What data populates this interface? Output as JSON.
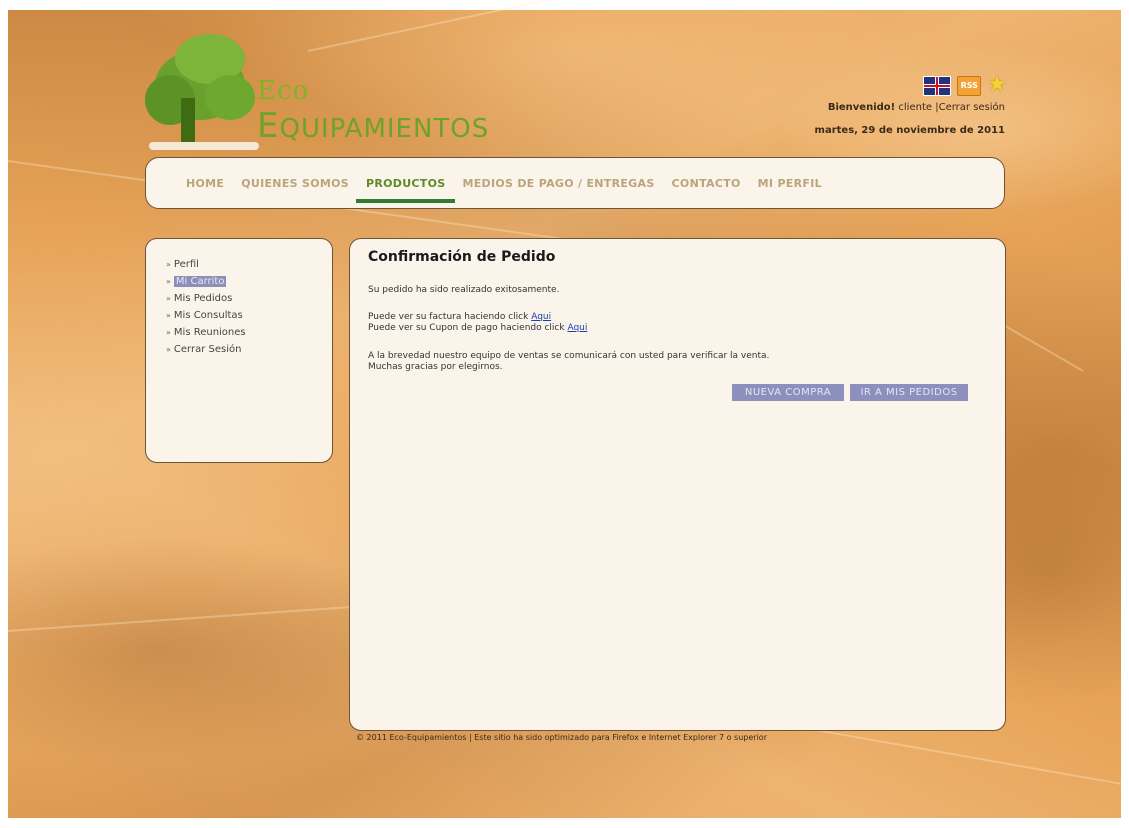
{
  "brand": {
    "logo_line1": "Eco",
    "logo_line2_initial": "E",
    "logo_line2_rest": "QUIPAMIENTOS"
  },
  "header": {
    "welcome_prefix": "Bienvenido!",
    "welcome_user": "cliente",
    "logout_link": "Cerrar sesión",
    "date": "martes, 29 de noviembre de 2011",
    "icons": [
      "uk-flag-icon",
      "rss-icon",
      "star-icon"
    ]
  },
  "nav": {
    "items": [
      {
        "label": "HOME"
      },
      {
        "label": "QUIENES SOMOS"
      },
      {
        "label": "PRODUCTOS",
        "active": true
      },
      {
        "label": "MEDIOS DE PAGO / ENTREGAS"
      },
      {
        "label": "CONTACTO"
      },
      {
        "label": "MI PERFIL"
      }
    ]
  },
  "sidebar": {
    "items": [
      {
        "label": "Perfil"
      },
      {
        "label": "Mi Carrito",
        "selected": true
      },
      {
        "label": "Mis Pedidos"
      },
      {
        "label": "Mis Consultas"
      },
      {
        "label": "Mis Reuniones"
      },
      {
        "label": "Cerrar Sesión"
      }
    ]
  },
  "main": {
    "title": "Confirmación de Pedido",
    "success": "Su pedido ha sido realizado exitosamente.",
    "invoice_text": "Puede ver su factura haciendo click",
    "invoice_link": "Aqui",
    "coupon_text": "Puede ver su Cupon de pago haciendo click",
    "coupon_link": "Aqui",
    "notice": "A la brevedad nuestro equipo de ventas se comunicará con usted para verificar la venta.",
    "thanks": "Muchas gracias por elegirnos.",
    "btn_new": "NUEVA COMPRA",
    "btn_orders": "IR A MIS PEDIDOS"
  },
  "footer": {
    "text": "© 2011 Eco-Equipamientos | Este sitio ha sido optimizado para Firefox e Internet Explorer 7 o superior"
  }
}
